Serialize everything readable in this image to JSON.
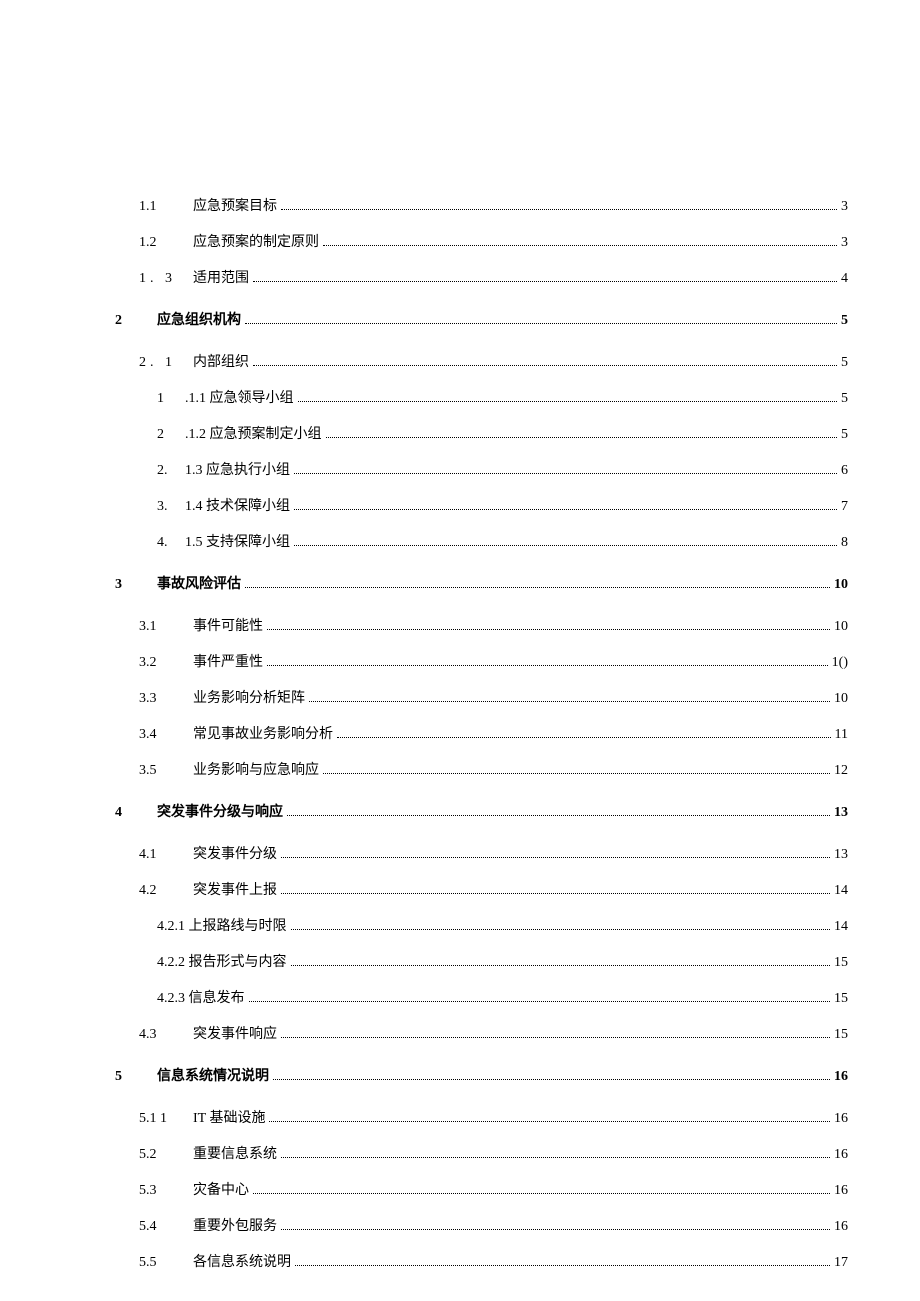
{
  "toc": [
    {
      "level": "level-2",
      "num": "1.1",
      "title": "应急预案目标",
      "page": "3"
    },
    {
      "level": "level-2",
      "num": "1.2",
      "title": "应急预案的制定原则",
      "page": "3"
    },
    {
      "level": "level-2b",
      "num": "1. 3",
      "title": "适用范围",
      "page": "4"
    },
    {
      "level": "level-1",
      "num": "2",
      "title": "应急组织机构",
      "page": "5"
    },
    {
      "level": "level-2b",
      "num": "2. 1",
      "title": "内部组织",
      "page": "5"
    },
    {
      "level": "level-3a",
      "num": "1",
      "title": ".1.1 应急领导小组",
      "page": "5"
    },
    {
      "level": "level-3a",
      "num": "2",
      "title": ".1.2 应急预案制定小组",
      "page": "5"
    },
    {
      "level": "level-3a",
      "num": "2.",
      "title": "1.3 应急执行小组",
      "page": "6"
    },
    {
      "level": "level-3a",
      "num": "3.",
      "title": "1.4 技术保障小组",
      "page": "7"
    },
    {
      "level": "level-3a",
      "num": "4.",
      "title": "1.5 支持保障小组",
      "page": "8"
    },
    {
      "level": "level-1",
      "num": "3",
      "title": "事故风险评估",
      "page": "10"
    },
    {
      "level": "level-2",
      "num": "3.1",
      "title": "事件可能性",
      "page": "10"
    },
    {
      "level": "level-2",
      "num": "3.2",
      "title": "事件严重性",
      "page": "1()"
    },
    {
      "level": "level-2",
      "num": "3.3",
      "title": "业务影响分析矩阵",
      "page": "10"
    },
    {
      "level": "level-2",
      "num": "3.4",
      "title": "常见事故业务影响分析",
      "page": "11"
    },
    {
      "level": "level-2",
      "num": "3.5",
      "title": "业务影响与应急响应",
      "page": "12"
    },
    {
      "level": "level-1",
      "num": "4",
      "title": "突发事件分级与响应",
      "page": "13"
    },
    {
      "level": "level-2",
      "num": "4.1",
      "title": "突发事件分级",
      "page": "13"
    },
    {
      "level": "level-2",
      "num": "4.2",
      "title": "突发事件上报",
      "page": "14"
    },
    {
      "level": "level-3b",
      "num": "",
      "title": "4.2.1 上报路线与时限",
      "page": "14"
    },
    {
      "level": "level-3b",
      "num": "",
      "title": "4.2.2 报告形式与内容",
      "page": "15"
    },
    {
      "level": "level-3b",
      "num": "",
      "title": "4.2.3 信息发布",
      "page": "15"
    },
    {
      "level": "level-2",
      "num": "4.3",
      "title": "突发事件响应",
      "page": "15"
    },
    {
      "level": "level-1",
      "num": "5",
      "title": "信息系统情况说明",
      "page": "16"
    },
    {
      "level": "level-2",
      "num": "5.1 1",
      "title": "IT 基础设施",
      "page": "16"
    },
    {
      "level": "level-2",
      "num": "5.2",
      "title": "重要信息系统",
      "page": "16"
    },
    {
      "level": "level-2",
      "num": "5.3",
      "title": "灾备中心",
      "page": "16"
    },
    {
      "level": "level-2",
      "num": "5.4",
      "title": "重要外包服务",
      "page": "16"
    },
    {
      "level": "level-2",
      "num": "5.5",
      "title": "各信息系统说明",
      "page": "17"
    }
  ]
}
